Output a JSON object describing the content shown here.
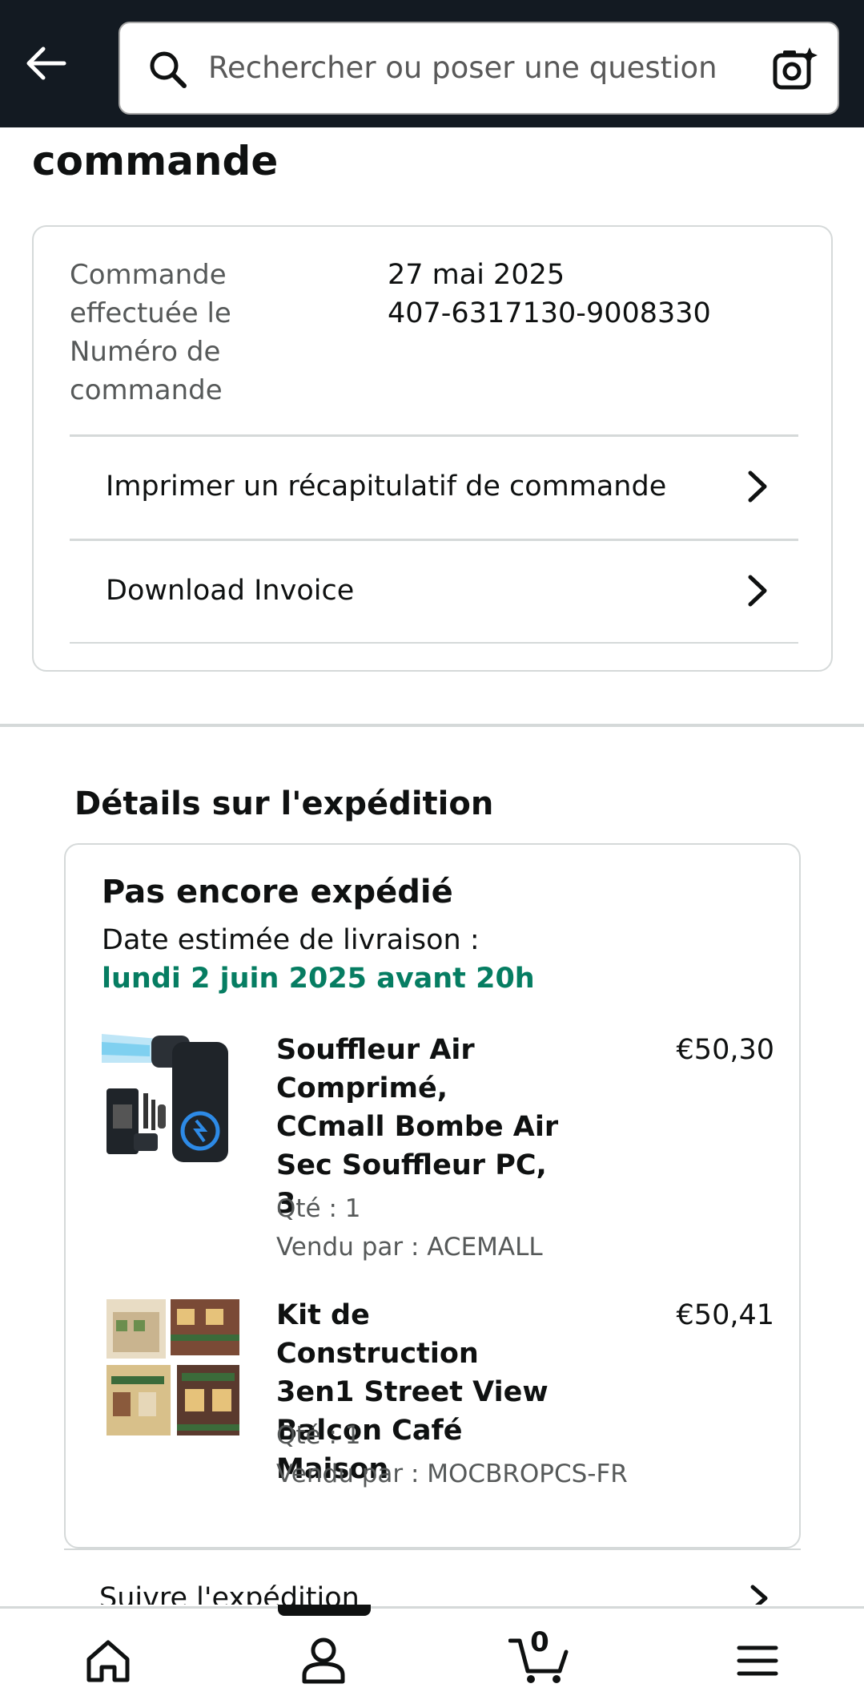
{
  "search": {
    "placeholder": "Rechercher ou poser une question"
  },
  "page": {
    "title": "commande"
  },
  "summary": {
    "order_date_label": "Commande effectuée le",
    "order_number_label": "Numéro de commande",
    "order_date": "27 mai 2025",
    "order_number": "407-6317130-9008330",
    "print_summary_label": "Imprimer un récapitulatif de commande",
    "download_invoice_label": "Download Invoice"
  },
  "shipment": {
    "heading": "Détails sur l'expédition",
    "status": "Pas encore expédié",
    "eta_label": "Date estimée de livraison :",
    "eta_date": "lundi 2 juin 2025 avant 20h",
    "items": [
      {
        "title": "Souffleur Air Comprimé, CCmall Bombe Air Sec Souffleur PC, 3",
        "price": "€50,30",
        "qty": "Qté : 1",
        "seller": "Vendu par : ACEMALL"
      },
      {
        "title": "Kit de Construction 3en1 Street View Balcon Café Maison",
        "price": "€50,41",
        "qty": "Qté : 1",
        "seller": "Vendu par : MOCBROPCS-FR"
      }
    ],
    "track_label": "Suivre l'expédition"
  },
  "nav": {
    "cart_count": "0",
    "icons": [
      "home-icon",
      "account-icon",
      "cart-icon",
      "menu-icon"
    ]
  },
  "colors": {
    "topbar": "#131a22",
    "eta_green": "#067d62",
    "border": "#d5d9d9"
  }
}
